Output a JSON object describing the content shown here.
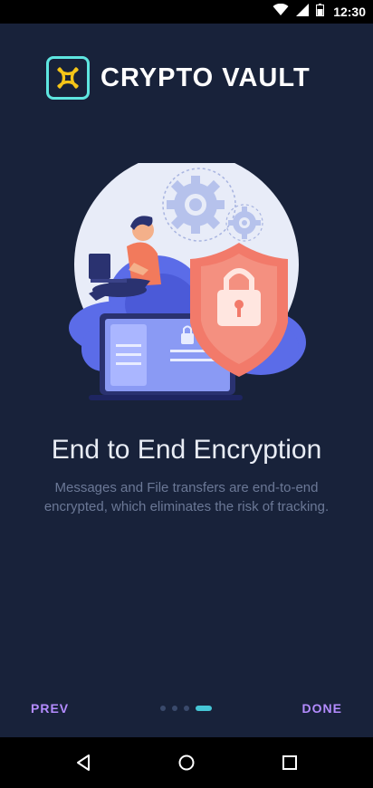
{
  "status_bar": {
    "time": "12:30",
    "icons": [
      "wifi-icon",
      "signal-icon",
      "battery-icon"
    ]
  },
  "app": {
    "name": "CRYPTO VAULT",
    "logo_icon": "crypto-logo-icon",
    "accent_color": "#5ee6e0",
    "logo_symbol_color": "#f5c518"
  },
  "onboarding": {
    "illustration": "person-with-laptop-cloud-shield-lock-illustration",
    "title": "End to End Encryption",
    "description": "Messages and File transfers are end-to-end encrypted, which eliminates the risk of tracking.",
    "pagination": {
      "total": 4,
      "current": 4
    },
    "prev_label": "PREV",
    "done_label": "DONE"
  },
  "system_nav": {
    "keys": [
      "back-icon",
      "home-icon",
      "recents-icon"
    ]
  },
  "colors": {
    "background": "#18223a",
    "nav_button": "#b48cff",
    "active_dot": "#46c6d6"
  }
}
